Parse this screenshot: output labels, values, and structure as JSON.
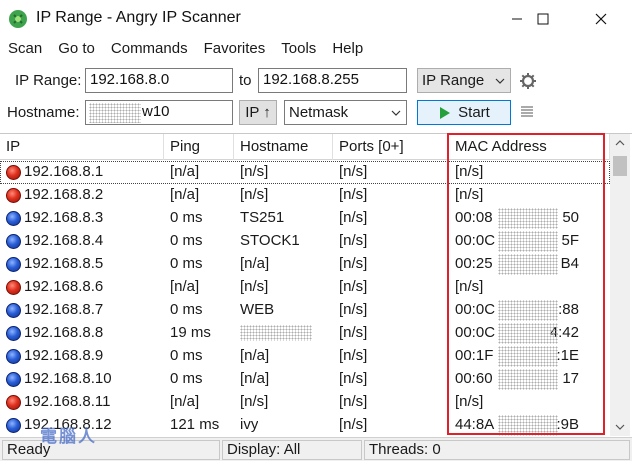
{
  "window": {
    "title": "IP Range - Angry IP Scanner"
  },
  "menu": [
    "Scan",
    "Go to",
    "Commands",
    "Favorites",
    "Tools",
    "Help"
  ],
  "toolbar": {
    "ip_range_label": "IP Range:",
    "range_start": "192.168.8.0",
    "to_label": "to",
    "range_end": "192.168.8.255",
    "feeder_select": "IP Range",
    "hostname_label": "Hostname:",
    "hostname_value": "w10",
    "ip_up_button": "IP ↑",
    "netmask_select": "Netmask",
    "start_button": "Start"
  },
  "table": {
    "columns": [
      "IP",
      "Ping",
      "Hostname",
      "Ports [0+]",
      "MAC Address"
    ],
    "rows": [
      {
        "status": "dead",
        "ip": "192.168.8.1",
        "ping": "[n/a]",
        "hostname": "[n/s]",
        "ports": "[n/s]",
        "mac": "[n/s]"
      },
      {
        "status": "dead",
        "ip": "192.168.8.2",
        "ping": "[n/a]",
        "hostname": "[n/s]",
        "ports": "[n/s]",
        "mac": "[n/s]"
      },
      {
        "status": "alive",
        "ip": "192.168.8.3",
        "ping": "0 ms",
        "hostname": "TS251",
        "ports": "[n/s]",
        "mac_start": "00:08",
        "mac_end": "50"
      },
      {
        "status": "alive",
        "ip": "192.168.8.4",
        "ping": "0 ms",
        "hostname": "STOCK1",
        "ports": "[n/s]",
        "mac_start": "00:0C",
        "mac_end": "5F"
      },
      {
        "status": "alive",
        "ip": "192.168.8.5",
        "ping": "0 ms",
        "hostname": "[n/a]",
        "ports": "[n/s]",
        "mac_start": "00:25",
        "mac_end": "B4"
      },
      {
        "status": "dead",
        "ip": "192.168.8.6",
        "ping": "[n/a]",
        "hostname": "[n/s]",
        "ports": "[n/s]",
        "mac": "[n/s]"
      },
      {
        "status": "alive",
        "ip": "192.168.8.7",
        "ping": "0 ms",
        "hostname": "WEB",
        "ports": "[n/s]",
        "mac_start": "00:0C",
        "mac_end": ":88"
      },
      {
        "status": "alive",
        "ip": "192.168.8.8",
        "ping": "19 ms",
        "hostname": "",
        "ports": "[n/s]",
        "mac_start": "00:0C",
        "mac_end": "4:42"
      },
      {
        "status": "alive",
        "ip": "192.168.8.9",
        "ping": "0 ms",
        "hostname": "[n/a]",
        "ports": "[n/s]",
        "mac_start": "00:1F",
        "mac_end": ":1E"
      },
      {
        "status": "alive",
        "ip": "192.168.8.10",
        "ping": "0 ms",
        "hostname": "[n/a]",
        "ports": "[n/s]",
        "mac_start": "00:60",
        "mac_end": "17"
      },
      {
        "status": "dead",
        "ip": "192.168.8.11",
        "ping": "[n/a]",
        "hostname": "[n/s]",
        "ports": "[n/s]",
        "mac": "[n/s]"
      },
      {
        "status": "alive",
        "ip": "192.168.8.12",
        "ping": "121 ms",
        "hostname": "ivy",
        "ports": "[n/s]",
        "mac_start": "44:8A",
        "mac_end": ":9B"
      }
    ]
  },
  "status": {
    "left": "Ready",
    "display": "Display: All",
    "threads": "Threads: 0"
  },
  "colors": {
    "highlight": "#e0202a",
    "alive": "#2a5fd8",
    "dead": "#e0301e"
  }
}
